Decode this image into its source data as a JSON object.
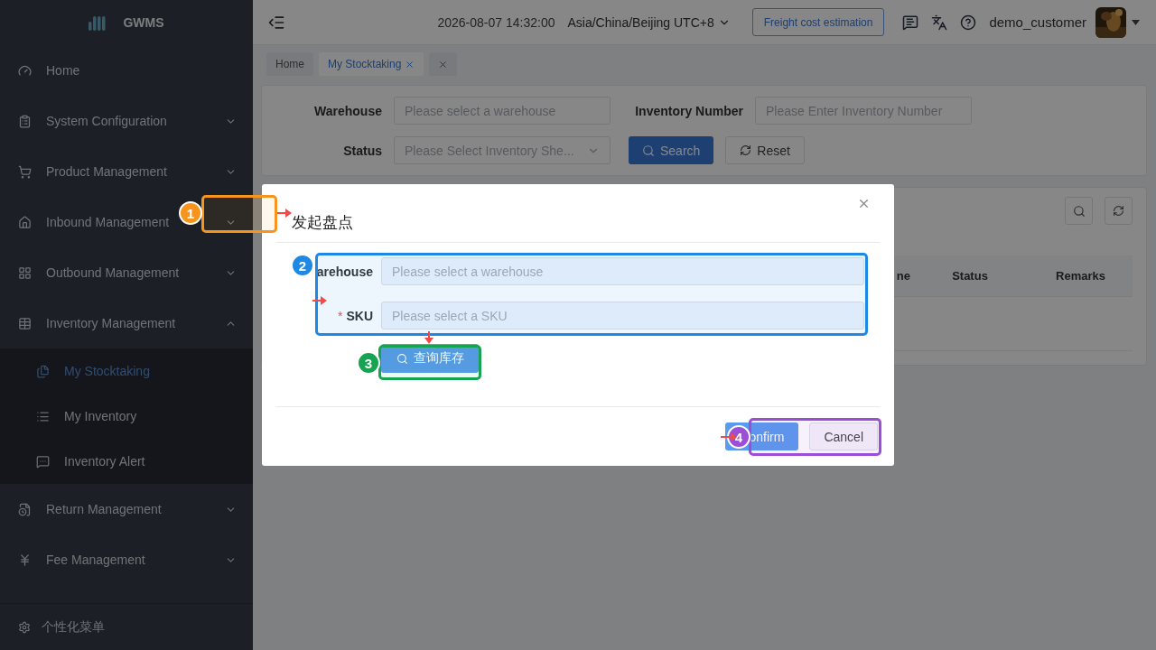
{
  "brand": {
    "name": "GWMS"
  },
  "sidebar": {
    "items": [
      {
        "label": "Home",
        "kind": "link"
      },
      {
        "label": "System Configuration",
        "kind": "group",
        "expanded": false
      },
      {
        "label": "Product Management",
        "kind": "group",
        "expanded": false
      },
      {
        "label": "Inbound Management",
        "kind": "group",
        "expanded": false
      },
      {
        "label": "Outbound Management",
        "kind": "group",
        "expanded": false
      },
      {
        "label": "Inventory Management",
        "kind": "group",
        "expanded": true,
        "children": [
          {
            "label": "My Stocktaking",
            "selected": true
          },
          {
            "label": "My Inventory",
            "selected": false
          },
          {
            "label": "Inventory Alert",
            "selected": false
          }
        ]
      },
      {
        "label": "Return Management",
        "kind": "group",
        "expanded": false
      },
      {
        "label": "Fee Management",
        "kind": "group",
        "expanded": false
      }
    ],
    "footer": "个性化菜单"
  },
  "header": {
    "datetime": "2026-08-07 14:32:00",
    "timezone": "Asia/China/Beijing UTC+8",
    "freight_button": "Freight cost estimation",
    "username": "demo_customer"
  },
  "tabs": [
    {
      "label": "Home",
      "selected": false,
      "closable": false
    },
    {
      "label": "My Stocktaking",
      "selected": true,
      "closable": true
    },
    {
      "selected": false,
      "closable": true
    }
  ],
  "filters": {
    "fields": [
      {
        "label": "Warehouse",
        "placeholder": "Please select a warehouse",
        "kind": "input"
      },
      {
        "label": "Inventory Number",
        "placeholder": "Please Enter Inventory Number",
        "kind": "input"
      },
      {
        "label": "Status",
        "placeholder": "Please Select Inventory She...",
        "kind": "select"
      }
    ],
    "search_button": "Search",
    "reset_button": "Reset"
  },
  "table": {
    "columns": [
      "ne",
      "Status",
      "Remarks"
    ]
  },
  "dialog": {
    "title": "发起盘点",
    "fields": [
      {
        "label": "arehouse",
        "placeholder": "Please select a warehouse"
      },
      {
        "label": "SKU",
        "required_mark": "*",
        "placeholder": "Please select a SKU"
      }
    ],
    "query_button": "查询库存",
    "confirm_button": "onfirm",
    "cancel_button": "Cancel"
  },
  "annotations": [
    {
      "number": "1",
      "color": "#f7941d"
    },
    {
      "number": "2",
      "color": "#1e88e5"
    },
    {
      "number": "3",
      "color": "#17a452"
    },
    {
      "number": "4",
      "color": "#9b4fd6"
    }
  ]
}
